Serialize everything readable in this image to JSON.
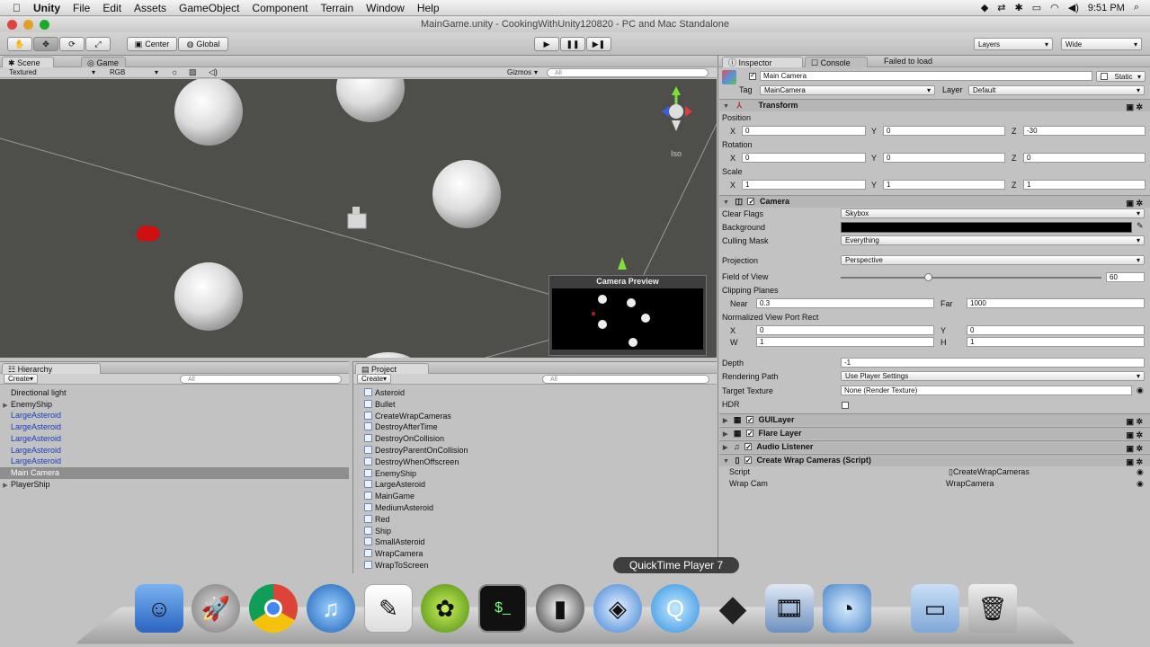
{
  "menubar": {
    "apple": "",
    "app": "Unity",
    "items": [
      "File",
      "Edit",
      "Assets",
      "GameObject",
      "Component",
      "Terrain",
      "Window",
      "Help"
    ],
    "clock": "9:51 PM"
  },
  "window": {
    "title": "MainGame.unity - CookingWithUnity120820 - PC and Mac Standalone"
  },
  "toolbar": {
    "pivot": "Center",
    "space": "Global",
    "layers": "Layers",
    "layout": "Wide"
  },
  "scene": {
    "tab_scene": "Scene",
    "tab_game": "Game",
    "render_mode": "Textured",
    "color_mode": "RGB",
    "gizmos": "Gizmos",
    "search_placeholder": "All",
    "persp_label": "Iso",
    "preview_title": "Camera Preview"
  },
  "hierarchy": {
    "tab": "Hierarchy",
    "create": "Create",
    "search_placeholder": "All",
    "items": [
      {
        "label": "Directional light",
        "style": "normal",
        "fold": false
      },
      {
        "label": "EnemyShip",
        "style": "normal",
        "fold": true
      },
      {
        "label": "LargeAsteroid",
        "style": "blue",
        "fold": false
      },
      {
        "label": "LargeAsteroid",
        "style": "blue",
        "fold": false
      },
      {
        "label": "LargeAsteroid",
        "style": "blue",
        "fold": false
      },
      {
        "label": "LargeAsteroid",
        "style": "blue",
        "fold": false
      },
      {
        "label": "LargeAsteroid",
        "style": "blue",
        "fold": false
      },
      {
        "label": "Main Camera",
        "style": "selected",
        "fold": false
      },
      {
        "label": "PlayerShip",
        "style": "normal",
        "fold": true
      }
    ]
  },
  "project": {
    "tab": "Project",
    "create": "Create",
    "search_placeholder": "All",
    "items": [
      "Asteroid",
      "Bullet",
      "CreateWrapCameras",
      "DestroyAfterTime",
      "DestroyOnCollision",
      "DestroyParentOnCollision",
      "DestroyWhenOffscreen",
      "EnemyShip",
      "LargeAsteroid",
      "MainGame",
      "MediumAsteroid",
      "Red",
      "Ship",
      "SmallAsteroid",
      "WrapCamera",
      "WrapToScreen"
    ]
  },
  "inspector": {
    "tab_inspector": "Inspector",
    "tab_console": "Console",
    "failed": "Failed to load",
    "object_name": "Main Camera",
    "static": "Static",
    "tag_label": "Tag",
    "tag": "MainCamera",
    "layer_label": "Layer",
    "layer": "Default",
    "transform": {
      "title": "Transform",
      "position": "Position",
      "px": "0",
      "py": "0",
      "pz": "-30",
      "rotation": "Rotation",
      "rx": "0",
      "ry": "0",
      "rz": "0",
      "scale": "Scale",
      "sx": "1",
      "sy": "1",
      "sz": "1",
      "x": "X",
      "y": "Y",
      "z": "Z"
    },
    "camera": {
      "title": "Camera",
      "clear_flags_label": "Clear Flags",
      "clear_flags": "Skybox",
      "background_label": "Background",
      "culling_label": "Culling Mask",
      "culling": "Everything",
      "projection_label": "Projection",
      "projection": "Perspective",
      "fov_label": "Field of View",
      "fov": "60",
      "clipping_label": "Clipping Planes",
      "near_label": "Near",
      "near": "0.3",
      "far_label": "Far",
      "far": "1000",
      "viewport_label": "Normalized View Port Rect",
      "vx_label": "X",
      "vx": "0",
      "vy_label": "Y",
      "vy": "0",
      "vw_label": "W",
      "vw": "1",
      "vh_label": "H",
      "vh": "1",
      "depth_label": "Depth",
      "depth": "-1",
      "rpath_label": "Rendering Path",
      "rpath": "Use Player Settings",
      "target_label": "Target Texture",
      "target": "None (Render Texture)",
      "hdr_label": "HDR"
    },
    "components": [
      "GUILayer",
      "Flare Layer",
      "Audio Listener"
    ],
    "script": {
      "title": "Create Wrap Cameras (Script)",
      "script_label": "Script",
      "script_value": "CreateWrapCameras",
      "wrap_label": "Wrap Cam",
      "wrap_value": "WrapCamera"
    }
  },
  "dock": {
    "tooltip": "QuickTime Player 7",
    "apps": [
      "finder-icon",
      "launchpad-icon",
      "chrome-icon",
      "itunes-icon",
      "textedit-icon",
      "app-icon",
      "terminal-icon",
      "instruments-icon",
      "safari-icon",
      "quicktime-icon",
      "unity-icon",
      "photo-icon",
      "preview-icon",
      "folder-icon",
      "trash-icon"
    ]
  }
}
